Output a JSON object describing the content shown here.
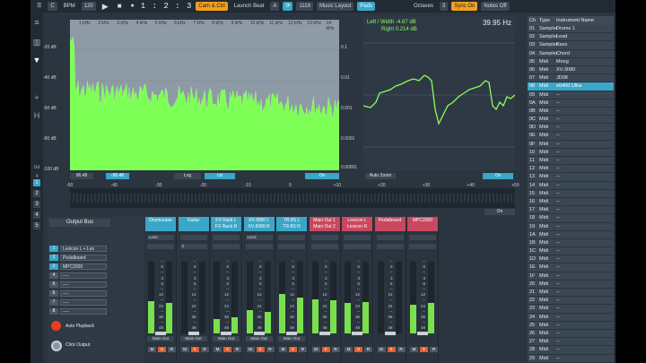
{
  "topbar": {
    "menu_icon": "menu-icon",
    "c_label": "C",
    "bpm_label": "BPM",
    "bpm_value": "120",
    "counter": "1 : 2 : 3",
    "cam_label": "Cam & Ctrl",
    "launch_label": "Launch Beat",
    "launch_value": "A",
    "device_value": "1118",
    "music_layout": "Music Layout",
    "pads_label": "Pads",
    "octaves_label": "Octaves",
    "octaves_value": "3",
    "syncon": "Sync On",
    "notes_off": "Notes Off"
  },
  "rail": {
    "label": "Gd 4",
    "numbers": [
      "1",
      "2",
      "3",
      "4",
      "5"
    ],
    "active_index": 0
  },
  "spectrum": {
    "ylabels": [
      "-20 dB",
      "-40 dB",
      "-60 dB",
      "-80 dB",
      "-100 dB"
    ],
    "yright": [
      "0.1",
      "0.01",
      "0.001",
      "0.0001",
      "0.00001"
    ],
    "xlabels": [
      "1 kHz",
      "2 kHz",
      "3 kHz",
      "4 kHz",
      "5 kHz",
      "6 kHz",
      "7 kHz",
      "8 kHz",
      "9 kHz",
      "10 kHz",
      "11 kHz",
      "12 kHz",
      "13 kHz",
      "14 kHz"
    ],
    "buttons": {
      "b1": "96.48",
      "b2": "-96.48",
      "log": "Log",
      "lin": "Lin",
      "on": "On"
    }
  },
  "phase": {
    "left_label": "Left / Width",
    "left_value": "-4.67 dB",
    "right_label": "Right",
    "right_value": "0.214 dB",
    "freq": "39.95 Hz",
    "auto_zoom": "Auto Zoom",
    "on": "On"
  },
  "correlation": {
    "scale": [
      "-50",
      "-40",
      "-30",
      "-20",
      "-10",
      "0",
      "+10",
      "+20",
      "+30",
      "+40",
      "+50"
    ],
    "on": "On"
  },
  "instruments": {
    "headers": [
      "Ch",
      "Type",
      "Instrument Name"
    ],
    "rows": [
      [
        "01",
        "Sampler",
        "Drums 1"
      ],
      [
        "02",
        "Sampler",
        "Lead"
      ],
      [
        "03",
        "Sampler",
        "Bass"
      ],
      [
        "04",
        "Sampler",
        "Chord"
      ],
      [
        "05",
        "Midi",
        "Moog"
      ],
      [
        "06",
        "Midi",
        "XV-3080"
      ],
      [
        "07",
        "Midi",
        "JD08"
      ],
      [
        "08",
        "Midi",
        "e6400 Ultra"
      ],
      [
        "09",
        "Midi",
        "--"
      ],
      [
        "0A",
        "Midi",
        "--"
      ],
      [
        "0B",
        "Midi",
        "--"
      ],
      [
        "0C",
        "Midi",
        "--"
      ],
      [
        "0D",
        "Midi",
        "--"
      ],
      [
        "0E",
        "Midi",
        "--"
      ],
      [
        "0F",
        "Midi",
        "--"
      ],
      [
        "10",
        "Midi",
        "--"
      ],
      [
        "11",
        "Midi",
        "--"
      ],
      [
        "12",
        "Midi",
        "--"
      ],
      [
        "13",
        "Midi",
        "--"
      ],
      [
        "14",
        "Midi",
        "--"
      ],
      [
        "15",
        "Midi",
        "--"
      ],
      [
        "16",
        "Midi",
        "--"
      ],
      [
        "17",
        "Midi",
        "--"
      ],
      [
        "18",
        "Midi",
        "--"
      ],
      [
        "19",
        "Midi",
        "--"
      ],
      [
        "1A",
        "Midi",
        "--"
      ],
      [
        "1B",
        "Midi",
        "--"
      ],
      [
        "1C",
        "Midi",
        "--"
      ],
      [
        "1D",
        "Midi",
        "--"
      ],
      [
        "1E",
        "Midi",
        "--"
      ],
      [
        "1F",
        "Midi",
        "--"
      ],
      [
        "20",
        "Midi",
        "--"
      ],
      [
        "21",
        "Midi",
        "--"
      ],
      [
        "22",
        "Midi",
        "--"
      ],
      [
        "23",
        "Midi",
        "--"
      ],
      [
        "24",
        "Midi",
        "--"
      ],
      [
        "25",
        "Midi",
        "--"
      ],
      [
        "26",
        "Midi",
        "--"
      ],
      [
        "27",
        "Midi",
        "--"
      ],
      [
        "28",
        "Midi",
        "--"
      ],
      [
        "29",
        "Midi",
        "--"
      ]
    ],
    "selected_index": 7
  },
  "mixer": {
    "output_bus": {
      "title": "Output Bus",
      "items": [
        {
          "num": "1",
          "name": "Lexicon L + Lex"
        },
        {
          "num": "2",
          "name": "Pedalboard"
        },
        {
          "num": "3",
          "name": "MPC2000"
        },
        {
          "num": "4",
          "name": "----"
        },
        {
          "num": "5",
          "name": "----"
        },
        {
          "num": "6",
          "name": "----"
        },
        {
          "num": "7",
          "name": "----"
        },
        {
          "num": "8",
          "name": "----"
        }
      ],
      "auto_playback": "Auto Playback",
      "click_output": "Click Output"
    },
    "scale": [
      "--",
      "0",
      "--",
      "3",
      "6",
      "--",
      "12",
      "--",
      "24",
      "--",
      "36",
      "--",
      "48",
      "--"
    ],
    "strips": [
      {
        "title": "Drumcease",
        "sub": "",
        "color": "blue",
        "row1": "Lexic",
        "row2": "",
        "out": "Main Out",
        "meters": [
          0.45,
          0.42
        ]
      },
      {
        "title": "Guitar",
        "sub": "",
        "color": "blue",
        "row1": "",
        "row2": "2",
        "out": "Main Out",
        "meters": [
          0.0,
          0.0
        ]
      },
      {
        "title": "FX Rack L",
        "sub": "FX Rack R",
        "color": "blue",
        "row1": "",
        "row2": "",
        "out": "Main Out",
        "meters": [
          0.2,
          0.22
        ]
      },
      {
        "title": "XV-3080 L",
        "sub": "XV-3080 R",
        "color": "blue",
        "row1": "Lexic",
        "row2": "",
        "out": "Main Out",
        "meters": [
          0.32,
          0.3
        ]
      },
      {
        "title": "TR-8S L",
        "sub": "TR-8S R",
        "color": "blue",
        "row1": "",
        "row2": "",
        "out": "Main Out",
        "meters": [
          0.55,
          0.5
        ]
      },
      {
        "title": "Main Out 1",
        "sub": "Main Out 2",
        "color": "red",
        "row1": "",
        "row2": "",
        "out": "",
        "meters": [
          0.48,
          0.46
        ]
      },
      {
        "title": "Lexicon L",
        "sub": "Lexicon R",
        "color": "red",
        "row1": "",
        "row2": "",
        "out": "",
        "meters": [
          0.42,
          0.44
        ]
      },
      {
        "title": "Pedalboard",
        "sub": "",
        "color": "red",
        "row1": "",
        "row2": "",
        "out": "",
        "meters": [
          0.0,
          0.0
        ]
      },
      {
        "title": "MPC2000",
        "sub": "",
        "color": "red",
        "row1": "",
        "row2": "",
        "out": "",
        "meters": [
          0.4,
          0.42
        ]
      }
    ]
  }
}
